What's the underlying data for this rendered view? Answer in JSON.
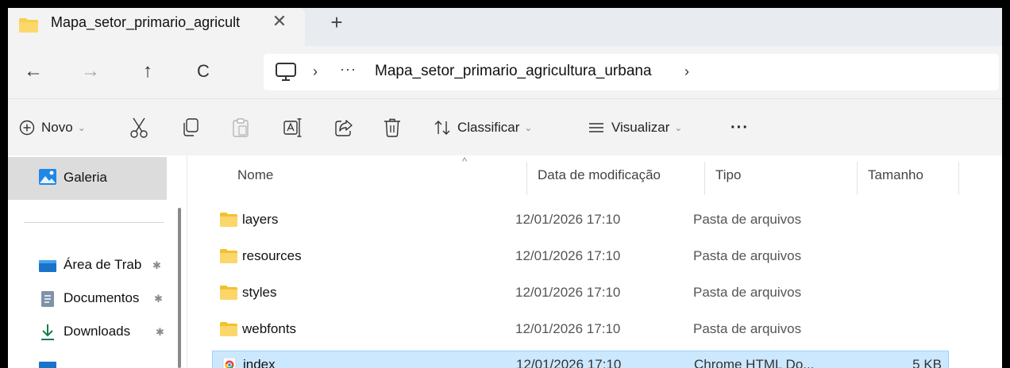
{
  "tab": {
    "title": "Mapa_setor_primario_agricult",
    "close_glyph": "✕",
    "new_tab_glyph": "+"
  },
  "address": {
    "back_glyph": "←",
    "forward_glyph": "→",
    "up_glyph": "↑",
    "refresh_glyph": "C",
    "separator_glyph": "›",
    "ellipsis": "···",
    "current_folder": "Mapa_setor_primario_agricultura_urbana"
  },
  "toolbar": {
    "new_label": "Novo",
    "sort_label": "Classificar",
    "view_label": "Visualizar",
    "more_glyph": "···",
    "chevron_glyph": "⌄"
  },
  "nav": {
    "gallery_label": "Galeria",
    "pin_glyph": "📌",
    "items": [
      {
        "label": "Área de Trab",
        "icon": "desktop-icon"
      },
      {
        "label": "Documentos",
        "icon": "documents-icon"
      },
      {
        "label": "Downloads",
        "icon": "download-icon"
      }
    ]
  },
  "columns": {
    "name": "Nome",
    "date": "Data de modificação",
    "type": "Tipo",
    "size": "Tamanho",
    "sort_glyph": "^"
  },
  "files": [
    {
      "name": "layers",
      "date": "12/01/2026 17:10",
      "type": "Pasta de arquivos",
      "size": "",
      "icon": "folder-icon",
      "selected": false
    },
    {
      "name": "resources",
      "date": "12/01/2026 17:10",
      "type": "Pasta de arquivos",
      "size": "",
      "icon": "folder-icon",
      "selected": false
    },
    {
      "name": "styles",
      "date": "12/01/2026 17:10",
      "type": "Pasta de arquivos",
      "size": "",
      "icon": "folder-icon",
      "selected": false
    },
    {
      "name": "webfonts",
      "date": "12/01/2026 17:10",
      "type": "Pasta de arquivos",
      "size": "",
      "icon": "folder-icon",
      "selected": false
    },
    {
      "name": "index",
      "date": "12/01/2026 17:10",
      "type": "Chrome HTML Do...",
      "size": "5 KB",
      "icon": "chrome-html-icon",
      "selected": true
    }
  ],
  "colors": {
    "selection": "#cce8ff",
    "selection_border": "#99d1ff",
    "folder": "#f8cf4a",
    "toolbar_bg": "#f3f3f3"
  }
}
